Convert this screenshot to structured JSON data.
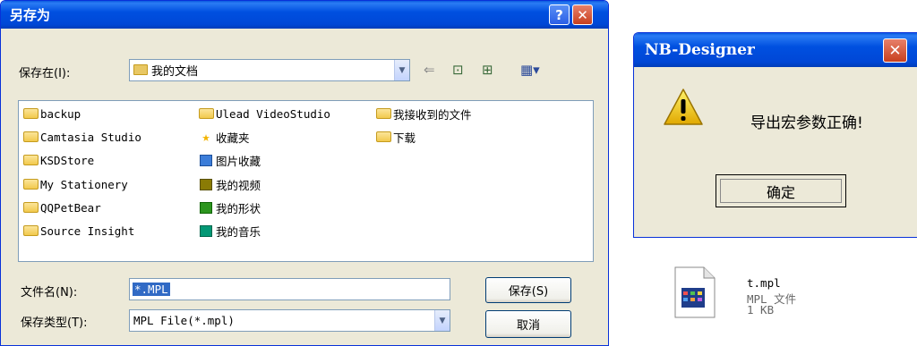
{
  "save_dialog": {
    "title": "另存为",
    "help_glyph": "?",
    "close_glyph": "✕",
    "save_in_label": "保存在",
    "save_in_mnemonic": "(I):",
    "save_in_value": "我的文档",
    "files": [
      {
        "name": "backup",
        "icon": "folder-icon"
      },
      {
        "name": "Camtasia Studio",
        "icon": "folder-icon"
      },
      {
        "name": "KSDStore",
        "icon": "folder-icon"
      },
      {
        "name": "My Stationery",
        "icon": "folder-icon"
      },
      {
        "name": "QQPetBear",
        "icon": "folder-icon"
      },
      {
        "name": "Source Insight",
        "icon": "folder-icon"
      },
      {
        "name": "Ulead VideoStudio",
        "icon": "folder-icon"
      },
      {
        "name": "收藏夹",
        "icon": "star-folder-icon"
      },
      {
        "name": "图片收藏",
        "icon": "pictures-folder-icon"
      },
      {
        "name": "我的视频",
        "icon": "videos-folder-icon"
      },
      {
        "name": "我的形状",
        "icon": "shapes-folder-icon"
      },
      {
        "name": "我的音乐",
        "icon": "music-folder-icon"
      },
      {
        "name": "我接收到的文件",
        "icon": "folder-icon"
      },
      {
        "name": "下载",
        "icon": "folder-icon"
      }
    ],
    "filename_label": "文件名",
    "filename_mnemonic": "(N):",
    "filename_value": "*.MPL",
    "filetype_label": "保存类型",
    "filetype_mnemonic": "(T):",
    "filetype_value": "MPL File(*.mpl)",
    "save_button": "保存(S)",
    "cancel_button": "取消"
  },
  "message_box": {
    "title": "NB-Designer",
    "close_glyph": "✕",
    "message": "导出宏参数正确!",
    "ok_button": "确定"
  },
  "desktop_file": {
    "name": "t.mpl",
    "type": "MPL 文件",
    "size": "1 KB"
  }
}
